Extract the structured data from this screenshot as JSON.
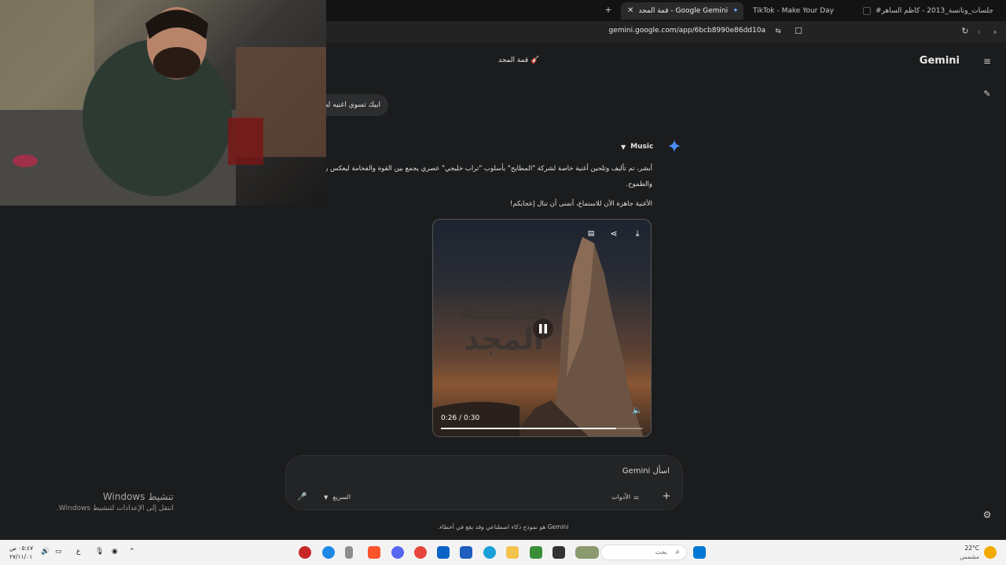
{
  "browser": {
    "tabs": [
      {
        "label": "TikTok - Make Your Day"
      },
      {
        "label": "‏قمة المجد - Google Gemini",
        "active": true
      },
      {
        "label": "#جلسات_ونانسة_2013 - كاظم الساهر"
      }
    ],
    "new_tab_label": "+",
    "url": "gemini.google.com/app/6bcb8990e86dd10a"
  },
  "gemini": {
    "brand": "Gemini",
    "chat_title": "قمة المجد",
    "user_message": "ابيك تسوي اغنيه لشركة",
    "model_label": "Music",
    "response_line1": "أبشر، تم تأليف وتلحين أغنية خاصة لشركة \"المطايح\" بأسلوب \"تراب خليجي\" عصري يجمع بين القوة والفخامة ليعكس روح",
    "response_line1b": "والطموح.",
    "response_line2": "الأغنية جاهزة الآن للاستماع، أتمنى أن تنال إعجابكم!",
    "video": {
      "title_line1": "قمـــة",
      "title_line2": "المجد",
      "time": "0:26 / 0:30",
      "progress": 0.867
    },
    "prompt_placeholder": "اسأل Gemini",
    "tools_label": "الأدوات",
    "mode_label": "السريع",
    "disclaimer": "Gemini هو نموذج ذكاء اصطناعي وقد يقع في أخطاء."
  },
  "windows_watermark": {
    "line1": "تنشيط Windows",
    "line2": "انتقل إلى الإعدادات لتنشيط Windows."
  },
  "taskbar": {
    "search_placeholder": "بحث",
    "weather_temp": "22°C",
    "weather_desc": "مشمس",
    "clock_time": "٠٥:٤٧ ص",
    "clock_date": "٢٧/١١/٠١",
    "lang": "ع"
  },
  "colors": {
    "app_bg": "#1b1c1d",
    "accent_spark": "#4a8df8"
  }
}
